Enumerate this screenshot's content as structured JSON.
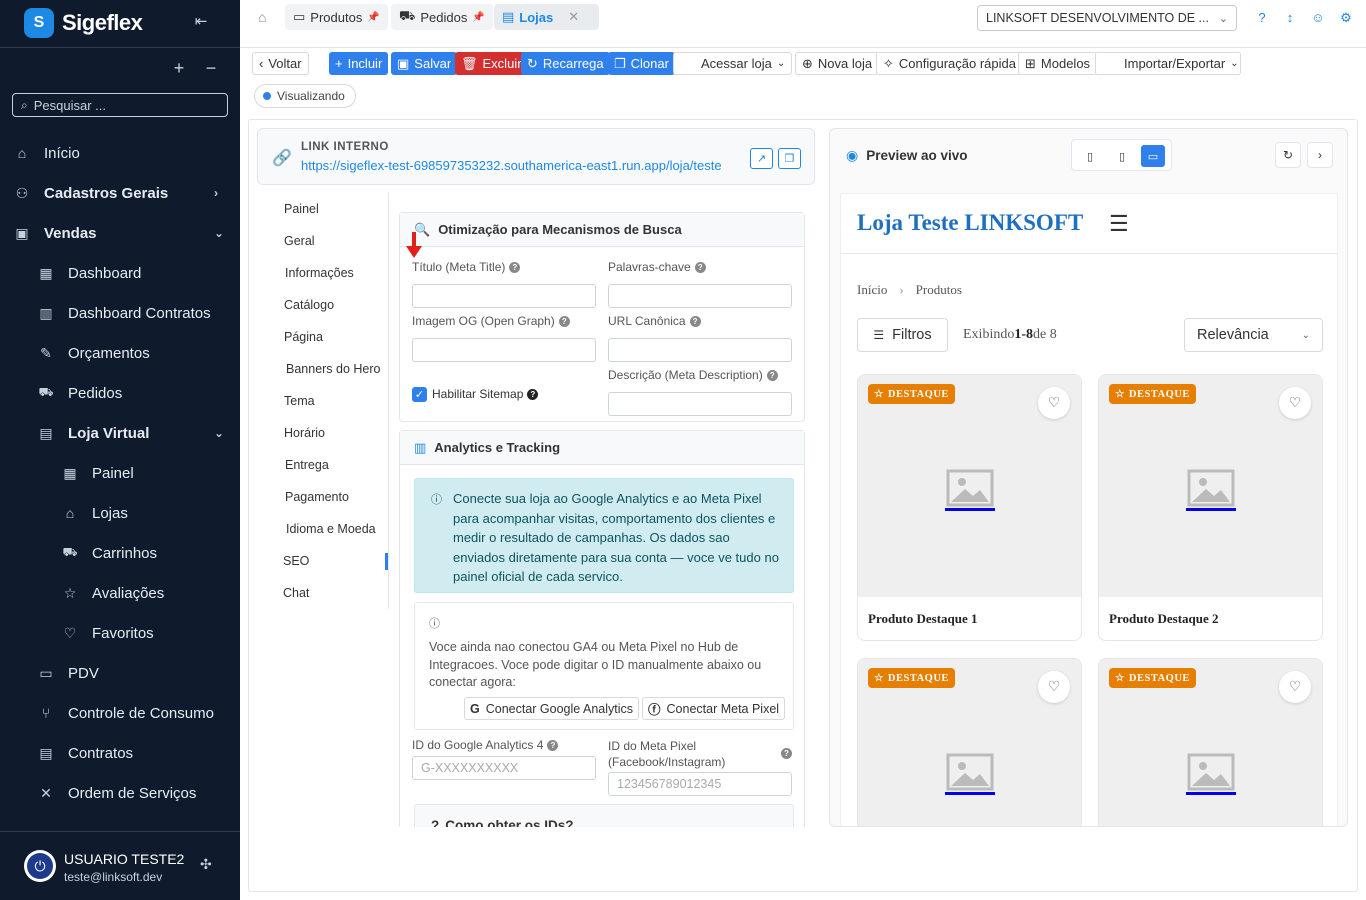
{
  "sidebar": {
    "brand": "Sigeflex",
    "brand_logo": "S",
    "search_placeholder": "Pesquisar ...",
    "items": [
      {
        "label": "Início",
        "icon": "home-icon",
        "glyph": "⌂"
      },
      {
        "label": "Cadastros Gerais",
        "icon": "users-icon",
        "glyph": "⚇"
      },
      {
        "label": "Vendas",
        "icon": "shopping-bag-icon",
        "glyph": "▣"
      },
      {
        "label": "Dashboard",
        "icon": "dashboard-icon",
        "glyph": "▦"
      },
      {
        "label": "Dashboard Contratos",
        "icon": "bar-chart-icon",
        "glyph": "▥"
      },
      {
        "label": "Orçamentos",
        "icon": "edit-document-icon",
        "glyph": "✎"
      },
      {
        "label": "Pedidos",
        "icon": "cart-icon",
        "glyph": "🛒"
      },
      {
        "label": "Loja Virtual",
        "icon": "storefront-icon",
        "glyph": "▤"
      },
      {
        "label": "Painel",
        "icon": "dashboard-icon",
        "glyph": "▦"
      },
      {
        "label": "Lojas",
        "icon": "store-icon",
        "glyph": "⌂"
      },
      {
        "label": "Carrinhos",
        "icon": "cart-icon",
        "glyph": "🛒"
      },
      {
        "label": "Avaliações",
        "icon": "star-icon",
        "glyph": "☆"
      },
      {
        "label": "Favoritos",
        "icon": "heart-icon",
        "glyph": "♡"
      },
      {
        "label": "PDV",
        "icon": "monitor-icon",
        "glyph": "▭"
      },
      {
        "label": "Controle de Consumo",
        "icon": "utensils-icon",
        "glyph": "⑂"
      },
      {
        "label": "Contratos",
        "icon": "contract-icon",
        "glyph": "▤"
      },
      {
        "label": "Ordem de Serviços",
        "icon": "tools-icon",
        "glyph": "✕"
      }
    ],
    "user": {
      "name": "USUARIO TESTE2",
      "email": "teste@linksoft.dev"
    }
  },
  "topbar": {
    "tabs": [
      {
        "label": "Produtos"
      },
      {
        "label": "Pedidos"
      },
      {
        "label": "Lojas"
      }
    ],
    "company": "LINKSOFT DESENVOLVIMENTO DE ..."
  },
  "toolbar": {
    "back": "Voltar",
    "include": "Incluir",
    "save": "Salvar",
    "delete": "Excluir",
    "reload": "Recarrega",
    "clone": "Clonar",
    "access_store": "Acessar loja",
    "new_store": "Nova loja",
    "quick_config": "Configuração rápida",
    "models": "Modelos",
    "import_export": "Importar/Exportar",
    "status": "Visualizando"
  },
  "link": {
    "label": "LINK INTERNO",
    "url": "https://sigeflex-test-698597353232.southamerica-east1.run.app/loja/teste"
  },
  "subnav": [
    "Painel",
    "Geral",
    "Informações",
    "Catálogo",
    "Página",
    "Banners do Hero",
    "Tema",
    "Horário",
    "Entrega",
    "Pagamento",
    "Idioma e Moeda",
    "SEO",
    "Chat"
  ],
  "seo": {
    "title": "Otimização para Mecanismos de Busca",
    "meta_title_label": "Título (Meta Title)",
    "keywords_label": "Palavras-chave",
    "og_image_label": "Imagem OG (Open Graph)",
    "canonical_label": "URL Canônica",
    "sitemap_label": "Habilitar Sitemap",
    "sitemap_enabled": true,
    "description_label": "Descrição (Meta Description)",
    "meta_title": "",
    "keywords": "",
    "og_image": "",
    "canonical": "",
    "description": ""
  },
  "analytics": {
    "title": "Analytics e Tracking",
    "info": "Conecte sua loja ao Google Analytics e ao Meta Pixel para acompanhar visitas, comportamento dos clientes e medir o resultado de campanhas. Os dados sao enviados diretamente para sua conta — voce ve tudo no painel oficial de cada servico.",
    "notice": "Voce ainda nao conectou GA4 ou Meta Pixel no Hub de Integracoes. Voce pode digitar o ID manualmente abaixo ou conectar agora:",
    "connect_ga": "Conectar Google Analytics",
    "connect_meta": "Conectar Meta Pixel",
    "ga_label": "ID do Google Analytics 4",
    "ga_placeholder": "G-XXXXXXXXXX",
    "pixel_label_1": "ID do Meta Pixel",
    "pixel_label_2": "(Facebook/Instagram)",
    "pixel_placeholder": "123456789012345",
    "howto": "Como obter os IDs?"
  },
  "preview": {
    "title": "Preview ao vivo",
    "store_name": "Loja Teste LINKSOFT",
    "crumb_home": "Início",
    "crumb_products": "Produtos",
    "filters": "Filtros",
    "showing_prefix": "Exibindo",
    "showing_range": "1-8",
    "showing_suffix": "de 8",
    "sort": "Relevância",
    "badge": "DESTAQUE",
    "products": [
      {
        "name": "Produto Destaque 1"
      },
      {
        "name": "Produto Destaque 2"
      },
      {
        "name": ""
      },
      {
        "name": ""
      }
    ]
  },
  "colors": {
    "primary": "#2f80ed",
    "danger": "#d32f2f",
    "sidebar": "#0f1b2d",
    "badge": "#e67e00",
    "link": "#1e88e5"
  }
}
